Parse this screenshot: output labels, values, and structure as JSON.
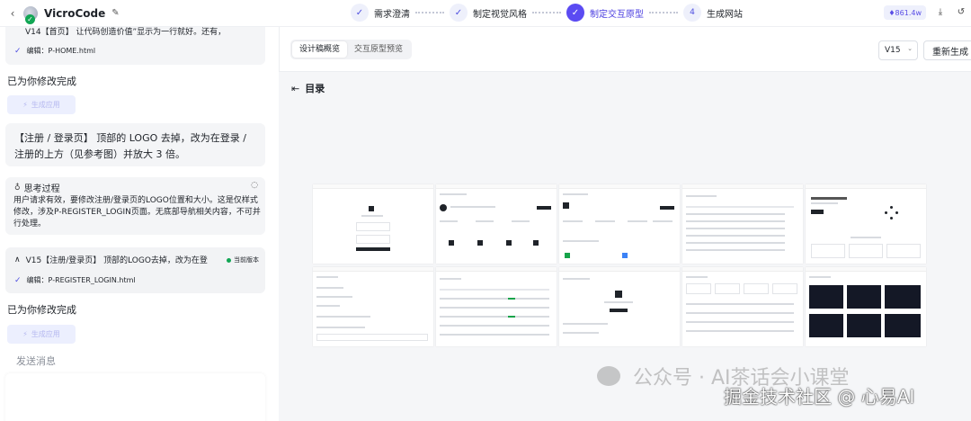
{
  "app": {
    "name": "VicroCode"
  },
  "steps": [
    {
      "label": "需求澄清",
      "state": "done"
    },
    {
      "label": "制定视觉风格",
      "state": "done"
    },
    {
      "label": "制定交互原型",
      "state": "active"
    },
    {
      "label": "生成网站",
      "state": "todo",
      "number": "4"
    }
  ],
  "header": {
    "credits": "861.4w"
  },
  "chat": {
    "v14": {
      "title": "V14【首页】 让代码创造价值”显示为一行就好。还有，",
      "file": "编辑：P-HOME.html"
    },
    "done_1": "已为你修改完成",
    "apply_1": "生成应用",
    "user_message": "【注册 / 登录页】 顶部的 LOGO 去掉，改为在登录 / 注册的上方（见参考图）并放大 3 倍。",
    "thinking": {
      "title": "思考过程",
      "body": "用户请求有效，要修改注册/登录页的LOGO位置和大小。这是仅样式修改，涉及P-REGISTER_LOGIN页面。无底部导航相关内容，不可并行处理。"
    },
    "v15": {
      "title": "V15【注册/登录页】 顶部的LOGO去掉，改为在登",
      "tag": "当前版本",
      "file": "编辑：P-REGISTER_LOGIN.html"
    },
    "done_2": "已为你修改完成",
    "apply_2": "生成应用",
    "send_placeholder": "发送消息"
  },
  "preview": {
    "tabs": [
      "设计稿概览",
      "交互原型预览"
    ],
    "active_tab": 0,
    "version": "V15",
    "regenerate": "重新生成",
    "toc": "目录",
    "thumbnail_count": 10
  },
  "watermark": {
    "line1": "公众号 · AI茶话会小课堂",
    "line2": "掘金技术社区 @ 心易AI"
  },
  "colors": {
    "accent": "#5b4bf2",
    "accent_soft": "#eef0fb",
    "success": "#11a654",
    "panel_bg": "#f4f5f7"
  }
}
